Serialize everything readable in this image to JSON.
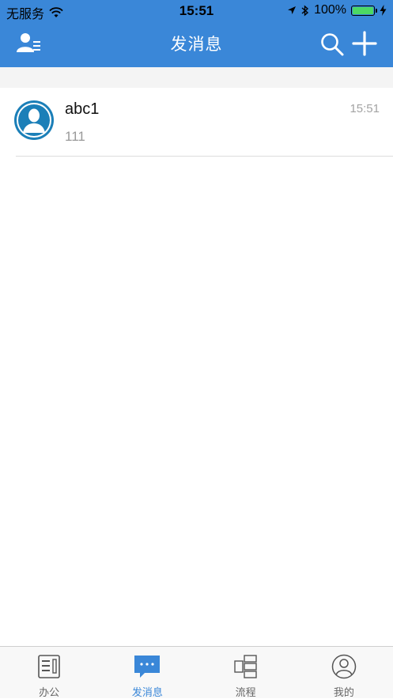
{
  "status_bar": {
    "carrier": "无服务",
    "time": "15:51",
    "battery": "100%"
  },
  "header": {
    "title": "发消息",
    "left_icon": "contacts-icon",
    "right_icons": [
      "search-icon",
      "add-icon"
    ]
  },
  "messages": [
    {
      "name": "abc1",
      "preview": "111",
      "time": "15:51",
      "avatar": "default-user-avatar"
    }
  ],
  "tabbar": {
    "active_tab": "发消息",
    "tabs": [
      {
        "label": "办公",
        "icon": "office-icon"
      },
      {
        "label": "发消息",
        "icon": "chat-bubble-icon"
      },
      {
        "label": "流程",
        "icon": "workflow-icon"
      },
      {
        "label": "我的",
        "icon": "profile-icon"
      }
    ]
  },
  "colors": {
    "brand_blue": "#3a87d8",
    "battery_green": "#4cd964"
  }
}
